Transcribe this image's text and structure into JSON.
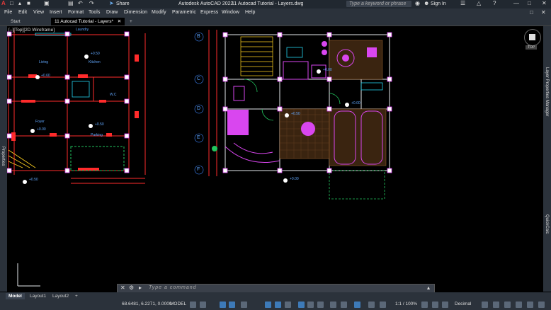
{
  "title": {
    "app": "Autodesk AutoCAD 2022",
    "file": "11 Autocad Tutorial - Layers.dwg",
    "share": "Share",
    "search_placeholder": "Type a keyword or phrase",
    "sign_in": "Sign In"
  },
  "menu": [
    "File",
    "Edit",
    "View",
    "Insert",
    "Format",
    "Tools",
    "Draw",
    "Dimension",
    "Modify",
    "Parametric",
    "Express",
    "Window",
    "Help"
  ],
  "tabs": {
    "start": "Start",
    "active": "11 Autocad Tutorial - Layers*",
    "add": "+"
  },
  "viewport": {
    "label": "[–][Top][2D Wireframe]",
    "compass_label": "TOP"
  },
  "grid_labels": [
    "B",
    "C",
    "D",
    "E",
    "F"
  ],
  "room_labels": [
    "Laundry",
    "Kitchen",
    "Living",
    "W.C",
    "Foyer",
    "Parking"
  ],
  "levels": [
    "+0.50",
    "+0.60",
    "+0.50",
    "+0.00",
    "+0.50",
    "+0.00",
    "+0.50",
    "+0.00",
    "+0.00"
  ],
  "side_palettes": {
    "left": "Properties",
    "right_top": "Layer Properties Manager",
    "right_bottom": "QuickCalc"
  },
  "command": {
    "placeholder": "Type a command"
  },
  "layout_tabs": [
    "Model",
    "Layout1",
    "Layout2",
    "+"
  ],
  "status": {
    "coords": "68.6481, 6.2271, 0.0000",
    "space": "MODEL",
    "scale": "1:1 / 100%",
    "units": "Decimal"
  },
  "colors": {
    "accent": "#3d7ab8",
    "chrome": "#2b323b",
    "canvas": "#000000"
  }
}
